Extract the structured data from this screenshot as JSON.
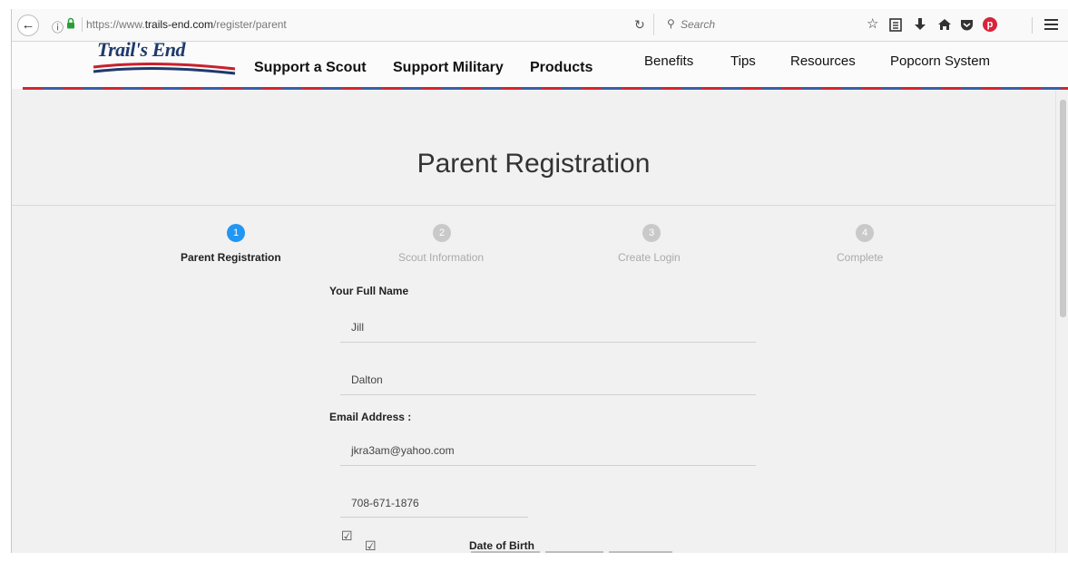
{
  "browser": {
    "url_prefix": "https://www.",
    "url_domain": "trails-end.com",
    "url_path": "/register/parent",
    "search_placeholder": "Search"
  },
  "icons": {
    "back": "back-arrow-icon",
    "info": "info-icon",
    "lock": "lock-icon",
    "reload": "reload-icon",
    "search": "search-icon",
    "bookmark": "bookmark-star-icon",
    "reading_list": "reading-list-icon",
    "download": "download-icon",
    "home": "home-icon",
    "pocket": "pocket-icon",
    "pinterest": "pinterest-icon",
    "menu": "menu-icon"
  },
  "site": {
    "logo_text": "Trail's End",
    "nav_main": [
      "Support a Scout",
      "Support Military",
      "Products"
    ],
    "nav_secondary": [
      "Benefits",
      "Tips",
      "Resources",
      "Popcorn System"
    ]
  },
  "page": {
    "title": "Parent Registration",
    "steps": [
      {
        "number": "1",
        "label": "Parent Registration",
        "active": true
      },
      {
        "number": "2",
        "label": "Scout Information",
        "active": false
      },
      {
        "number": "3",
        "label": "Create Login",
        "active": false
      },
      {
        "number": "4",
        "label": "Complete",
        "active": false
      }
    ],
    "form": {
      "full_name_label": "Your Full Name",
      "first_name": "Jill",
      "last_name": "Dalton",
      "email_label": "Email Address :",
      "email": "jkra3am@yahoo.com",
      "phone": "708-671-1876",
      "dob_label": "Date of Birth"
    }
  },
  "colors": {
    "active_step": "#2196f3",
    "inactive_step": "#c9c9c9",
    "stripe_red": "#d22630",
    "stripe_blue": "#3a5fb0"
  }
}
